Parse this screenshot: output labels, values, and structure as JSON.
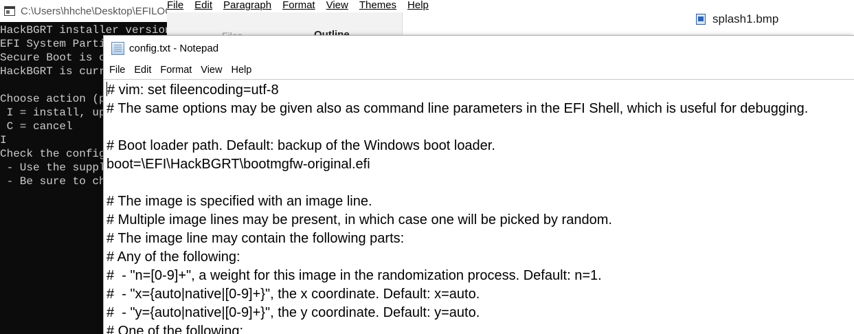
{
  "console": {
    "title": "C:\\Users\\hhche\\Desktop\\EFILOGO",
    "lines": [
      "HackBGRT installer version",
      "EFI System Partition",
      "Secure Boot is o",
      "HackBGRT is curr",
      "",
      "Choose action (p",
      " I = install, up",
      " C = cancel",
      "I",
      "Check the config",
      " - Use the suppl",
      " - Be sure to ch"
    ]
  },
  "wordpad": {
    "menu": [
      "File",
      "Edit",
      "Paragraph",
      "Format",
      "View",
      "Themes",
      "Help"
    ],
    "tabs": {
      "files": "Files",
      "outline": "Outline"
    },
    "file_name": "splash1.bmp"
  },
  "notepad": {
    "title": "config.txt - Notepad",
    "menu": [
      "File",
      "Edit",
      "Format",
      "View",
      "Help"
    ],
    "lines": [
      "# vim: set fileencoding=utf-8",
      "# The same options may be given also as command line parameters in the EFI Shell, which is useful for debugging.",
      "",
      "# Boot loader path. Default: backup of the Windows boot loader.",
      "boot=\\EFI\\HackBGRT\\bootmgfw-original.efi",
      "",
      "# The image is specified with an image line.",
      "# Multiple image lines may be present, in which case one will be picked by random.",
      "# The image line may contain the following parts:",
      "# Any of the following:",
      "#  - \"n=[0-9]+\", a weight for this image in the randomization process. Default: n=1.",
      "#  - \"x={auto|native|[0-9]+}\", the x coordinate. Default: x=auto.",
      "#  - \"y={auto|native|[0-9]+}\", the y coordinate. Default: y=auto.",
      "# One of the following:"
    ]
  }
}
